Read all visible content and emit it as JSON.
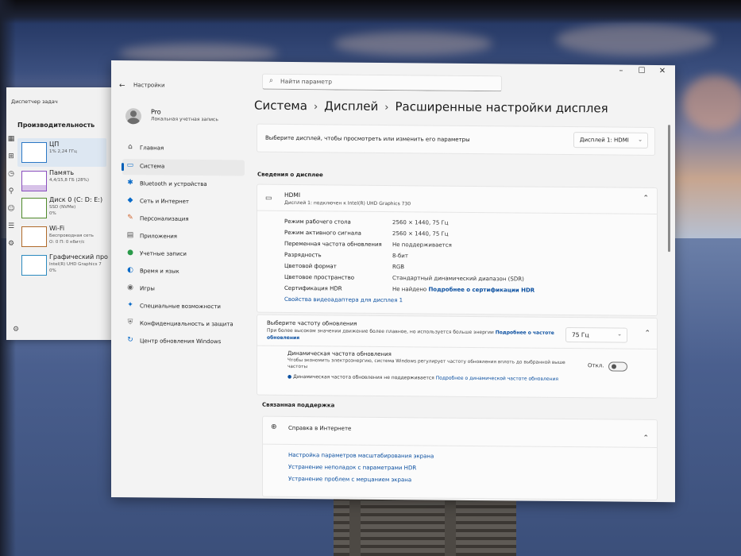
{
  "task_manager": {
    "title": "Диспетчер задач",
    "header": "Производительность",
    "items": [
      {
        "name": "ЦП",
        "sub": "1% 2,24 ГГц"
      },
      {
        "name": "Память",
        "sub": "4,4/15,8 ГБ (28%)"
      },
      {
        "name": "Диск 0 (C: D: E:)",
        "sub": "SSD (NVMe)\n0%"
      },
      {
        "name": "Wi-Fi",
        "sub": "Беспроводная сеть\nО: 0 П: 0 кбит/с"
      },
      {
        "name": "Графический про",
        "sub": "Intel(R) UHD Graphics 7\n0%"
      }
    ],
    "memory_usage_fraction": 0.28
  },
  "settings": {
    "app_title": "Настройки",
    "search_placeholder": "Найти параметр",
    "user": {
      "name": "Pro",
      "type": "Локальная учетная запись"
    },
    "nav": [
      {
        "label": "Главная",
        "icon": "home-icon"
      },
      {
        "label": "Система",
        "icon": "monitor-icon",
        "selected": true
      },
      {
        "label": "Bluetooth и устройства",
        "icon": "bluetooth-icon"
      },
      {
        "label": "Сеть и Интернет",
        "icon": "wifi-icon"
      },
      {
        "label": "Персонализация",
        "icon": "brush-icon"
      },
      {
        "label": "Приложения",
        "icon": "apps-icon"
      },
      {
        "label": "Учетные записи",
        "icon": "person-icon"
      },
      {
        "label": "Время и язык",
        "icon": "globe-clock-icon"
      },
      {
        "label": "Игры",
        "icon": "gamepad-icon"
      },
      {
        "label": "Специальные возможности",
        "icon": "accessibility-icon"
      },
      {
        "label": "Конфиденциальность и защита",
        "icon": "shield-icon"
      },
      {
        "label": "Центр обновления Windows",
        "icon": "update-icon"
      }
    ],
    "breadcrumb": [
      "Система",
      "Дисплей",
      "Расширенные настройки дисплея"
    ],
    "select_display": {
      "label": "Выберите дисплей, чтобы просмотреть или изменить его параметры",
      "value": "Дисплей 1: HDMI"
    },
    "display_info": {
      "section": "Сведения о дисплее",
      "name": "HDMI",
      "subtitle": "Дисплей 1: подключен к Intel(R) UHD Graphics 730",
      "rows": [
        {
          "key": "Режим рабочего стола",
          "value": "2560 × 1440, 75 Гц"
        },
        {
          "key": "Режим активного сигнала",
          "value": "2560 × 1440, 75 Гц"
        },
        {
          "key": "Переменная частота обновления",
          "value": "Не поддерживается"
        },
        {
          "key": "Разрядность",
          "value": "8-бит"
        },
        {
          "key": "Цветовой формат",
          "value": "RGB"
        },
        {
          "key": "Цветовое пространство",
          "value": "Стандартный динамический диапазон (SDR)"
        }
      ],
      "hdr_key": "Сертификация HDR",
      "hdr_value": "Не найдено",
      "hdr_link": "Подробнее о сертификации HDR",
      "adapter_link": "Свойства видеоадаптера для дисплея 1"
    },
    "refresh": {
      "title": "Выберите частоту обновления",
      "desc": "При более высоком значении движение более плавное, но используется больше энергии",
      "link1": "Подробнее о частоте",
      "link2": "обновления",
      "value": "75 Гц"
    },
    "dynamic": {
      "title": "Динамическая частота обновления",
      "desc1": "Чтобы экономить электроэнергию, система Windows регулирует частоту обновления вплоть до выбранной выше",
      "desc2": "частоты",
      "note": "Динамическая частота обновления не поддерживается",
      "link": "Подробнее о динамической частоте обновления",
      "state": "Откл."
    },
    "support": {
      "section": "Связанная поддержка",
      "help": "Справка в Интернете",
      "links": [
        "Настройка параметров масштабирования экрана",
        "Устранение неполадок с параметрами HDR",
        "Устранение проблем с мерцанием экрана"
      ]
    }
  }
}
